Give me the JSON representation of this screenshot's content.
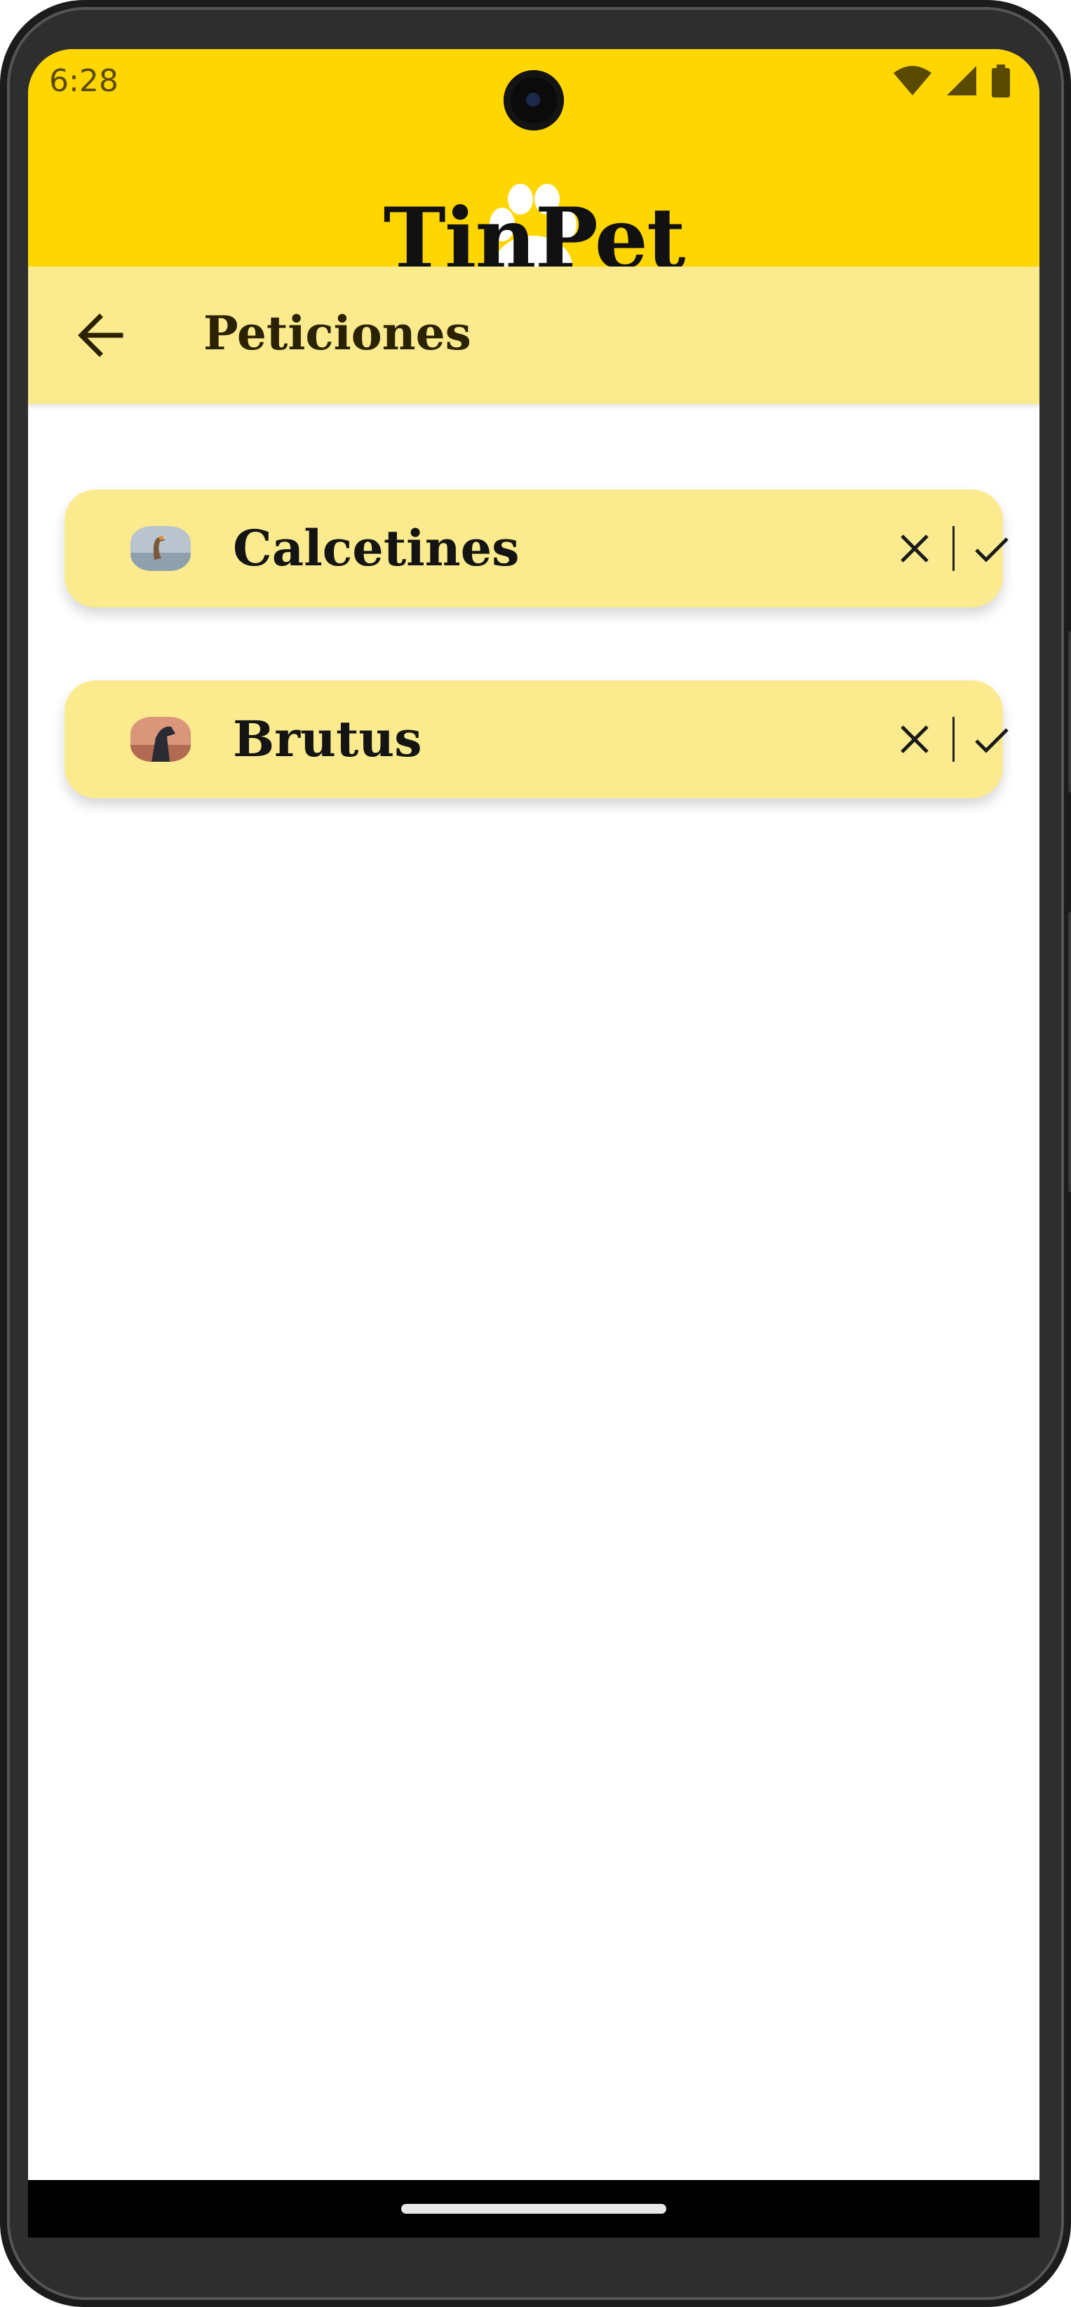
{
  "status_bar": {
    "time": "6:28",
    "icons": [
      "wifi-icon",
      "signal-icon",
      "battery-icon"
    ]
  },
  "header": {
    "brand": "TinPet",
    "logo_icon": "paw-icon",
    "background_color": "#FFD600"
  },
  "app_bar": {
    "back_icon": "arrow-back-icon",
    "title": "Peticiones",
    "background_color": "#FBEB8E"
  },
  "requests": [
    {
      "pet_name": "Calcetines",
      "reject_icon": "close-icon",
      "accept_icon": "check-icon"
    },
    {
      "pet_name": "Brutus",
      "reject_icon": "close-icon",
      "accept_icon": "check-icon"
    }
  ],
  "colors": {
    "accent": "#FFD600",
    "card": "#FBEB8E",
    "text": "#141414"
  }
}
